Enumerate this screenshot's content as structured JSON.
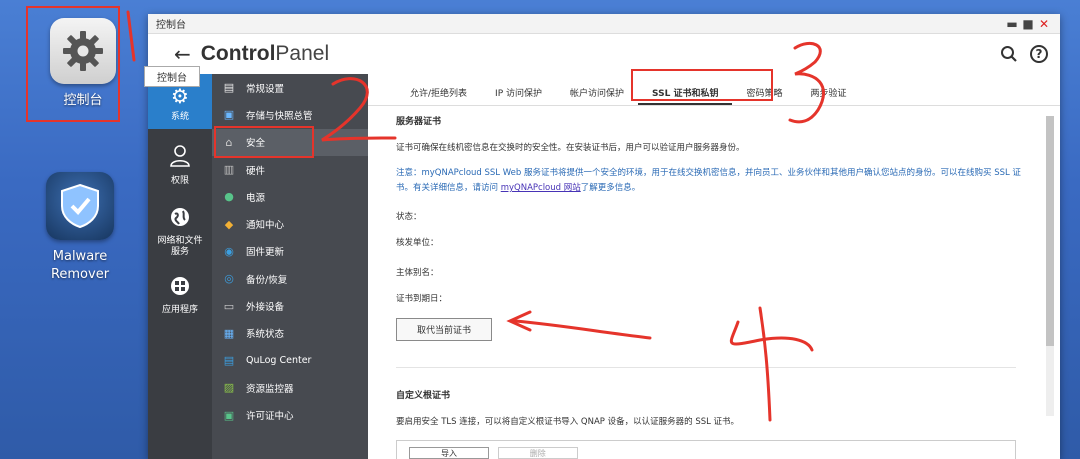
{
  "desktop": {
    "control_panel_label": "控制台",
    "malware_label_1": "Malware",
    "malware_label_2": "Remover"
  },
  "window": {
    "title": "控制台",
    "header_title_bold": "Control",
    "header_title_rest": "Panel",
    "tooltip": "控制台",
    "controls": {
      "minimize": "▬",
      "maximize": "■",
      "close": "✕"
    }
  },
  "categories": [
    {
      "label": "系统",
      "icon": "gear-icon",
      "glyph": "⚙"
    },
    {
      "label": "权限",
      "icon": "user-icon",
      "glyph": "👤"
    },
    {
      "label": "网络和文件服务",
      "icon": "globe-icon",
      "glyph": "🌐"
    },
    {
      "label": "应用程序",
      "icon": "apps-icon",
      "glyph": "▦"
    }
  ],
  "menu": [
    {
      "label": "常规设置",
      "glyph": "▤",
      "color": "#e8e8e8"
    },
    {
      "label": "存储与快照总管",
      "glyph": "▣",
      "color": "#6ab7ff"
    },
    {
      "label": "安全",
      "glyph": "⌂",
      "color": "#d0d0d0"
    },
    {
      "label": "硬件",
      "glyph": "▥",
      "color": "#bdbdbd"
    },
    {
      "label": "电源",
      "glyph": "●",
      "color": "#58c48a"
    },
    {
      "label": "通知中心",
      "glyph": "◆",
      "color": "#f2b035"
    },
    {
      "label": "固件更新",
      "glyph": "◉",
      "color": "#3c9fe0"
    },
    {
      "label": "备份/恢复",
      "glyph": "◎",
      "color": "#3c9fe0"
    },
    {
      "label": "外接设备",
      "glyph": "▭",
      "color": "#cfcfcf"
    },
    {
      "label": "系统状态",
      "glyph": "▦",
      "color": "#6ab7ff"
    },
    {
      "label": "QuLog Center",
      "glyph": "▤",
      "color": "#3c9fe0"
    },
    {
      "label": "资源监控器",
      "glyph": "▨",
      "color": "#8bc34a"
    },
    {
      "label": "许可证中心",
      "glyph": "▣",
      "color": "#58c48a"
    }
  ],
  "tabs": [
    "允许/拒绝列表",
    "IP 访问保护",
    "帐户访问保护",
    "SSL 证书和私钥",
    "密码策略",
    "两步验证"
  ],
  "panel": {
    "server_cert_heading": "服务器证书",
    "desc": "证书可确保在线机密信息在交换时的安全性。在安装证书后，用户可以验证用户服务器身份。",
    "note_pre": "注意：myQNAPcloud SSL Web 服务证书将提供一个安全的环境，用于在线交换机密信息，并向员工、业务伙伴和其他用户确认您站点的身份。可以在线购买 SSL 证书。有关详细信息，请访问 ",
    "note_link": "myQNAPcloud 网站",
    "note_post": "了解更多信息。",
    "status_label": "状态：",
    "issuer_label": "核发单位：",
    "alias_label": "主体别名：",
    "expiry_label": "证书到期日：",
    "replace_button": "取代当前证书",
    "custom_root_heading": "自定义根证书",
    "custom_root_desc": "要启用安全 TLS 连接，可以将自定义根证书导入 QNAP 设备，以认证服务器的 SSL 证书。",
    "import_button": "导入",
    "delete_button": "删除"
  },
  "annotations": [
    "1",
    "2",
    "3",
    "4"
  ]
}
